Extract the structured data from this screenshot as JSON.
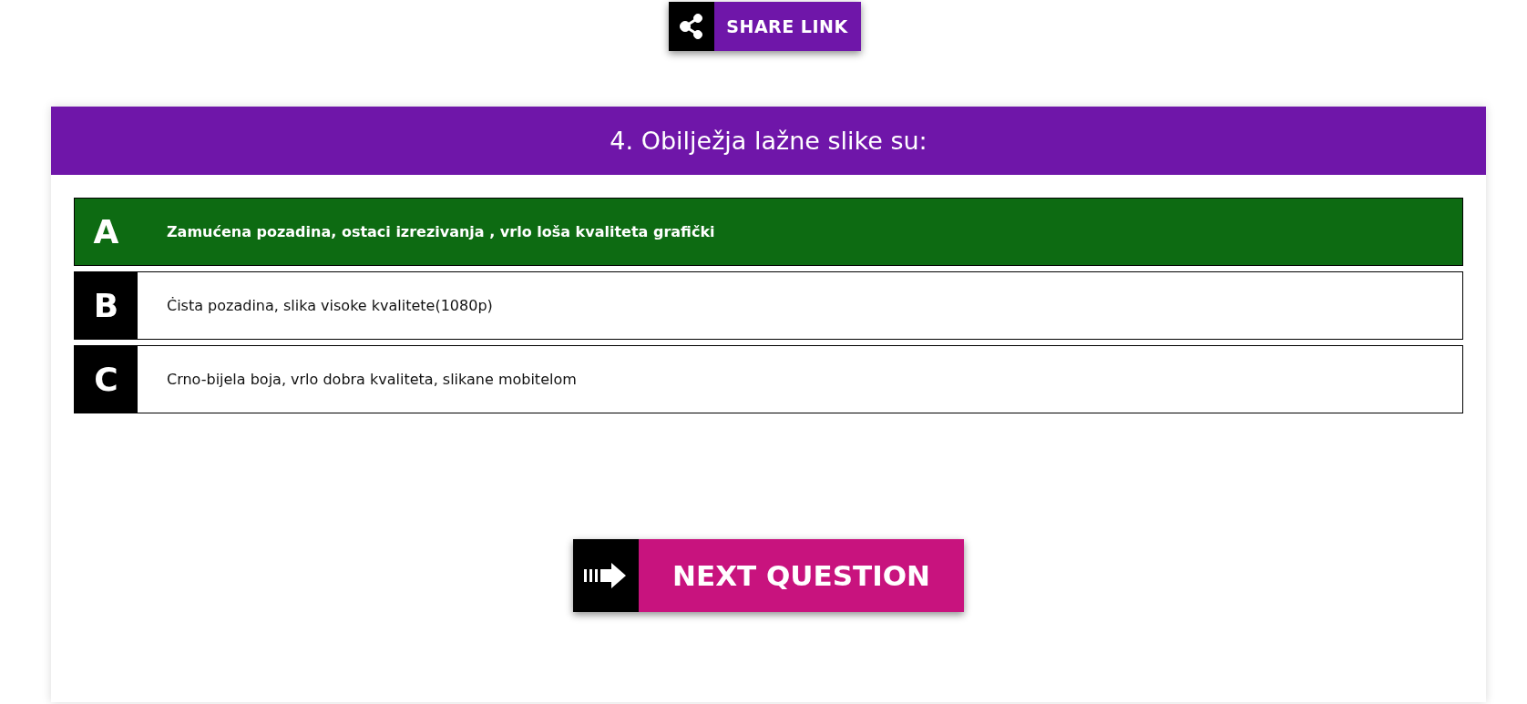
{
  "share_button": {
    "label": "SHARE LINK"
  },
  "question": {
    "title": "4. Obilježja lažne slike su:"
  },
  "answers": [
    {
      "letter": "A",
      "text": "Zamućena pozadina, ostaci izrezivanja , vrlo loša kvaliteta grafički",
      "correct": true
    },
    {
      "letter": "B",
      "text": "Ċista pozadina, slika visoke kvalitete(1080p)",
      "correct": false
    },
    {
      "letter": "C",
      "text": "Crno-bijela boja, vrlo dobra kvaliteta, slikane mobitelom",
      "correct": false
    }
  ],
  "next_button": {
    "label": "NEXT QUESTION"
  }
}
